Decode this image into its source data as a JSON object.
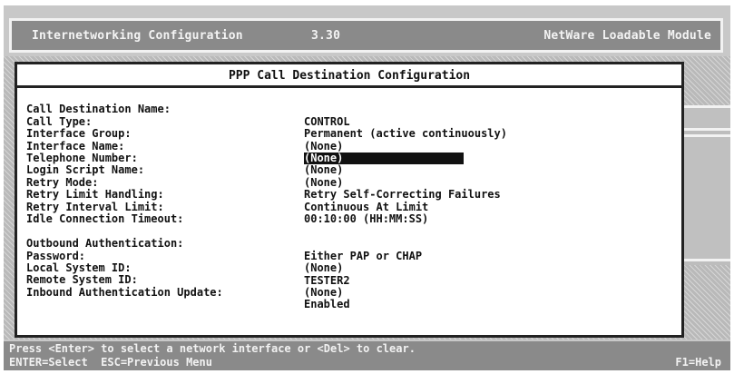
{
  "header": {
    "title": "Internetworking Configuration",
    "version": "3.30",
    "module": "NetWare Loadable Module"
  },
  "dialog": {
    "title": "PPP Call Destination Configuration",
    "fields": [
      {
        "label": "Call Destination Name:",
        "value": "CONTROL"
      },
      {
        "label": "Call Type:",
        "value": "Permanent (active continuously)"
      },
      {
        "label": "Interface Group:",
        "value": "(None)"
      },
      {
        "label": "Interface Name:",
        "value": "(None)"
      },
      {
        "label": "Telephone Number:",
        "value": "(None)"
      },
      {
        "label": "Login Script Name:",
        "value": "(None)"
      },
      {
        "label": "Retry Mode:",
        "value": "Retry Self-Correcting Failures"
      },
      {
        "label": "Retry Limit Handling:",
        "value": "Continuous At Limit"
      },
      {
        "label": "Retry Interval Limit:",
        "value": "00:10:00 (HH:MM:SS)"
      },
      {
        "label": "Idle Connection Timeout:",
        "value": ""
      }
    ],
    "auth_fields": [
      {
        "label": "Outbound Authentication:",
        "value": "Either PAP or CHAP"
      },
      {
        "label": "Password:",
        "value": "(None)"
      },
      {
        "label": "Local System ID:",
        "value": "TESTER2"
      },
      {
        "label": "Remote System ID:",
        "value": "(None)"
      },
      {
        "label": "Inbound Authentication Update:",
        "value": "Enabled"
      }
    ]
  },
  "status": {
    "message": "Press <Enter> to select a network interface or <Del> to clear.",
    "keys": "ENTER=Select  ESC=Previous Menu",
    "help": "F1=Help"
  },
  "colors": {
    "screen_bg": "#c8c8c8",
    "header_bg": "#8a8a8a",
    "dialog_bg": "#ffffff",
    "highlight": "#111111"
  }
}
